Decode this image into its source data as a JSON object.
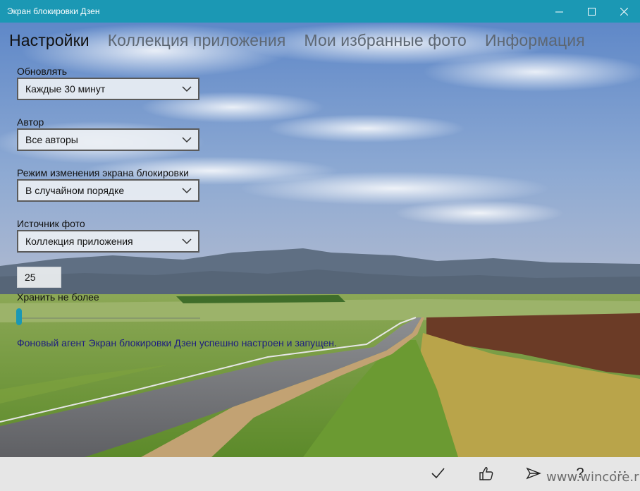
{
  "window": {
    "title": "Экран блокировки Дзен",
    "minimize_icon": "minimize-icon",
    "maximize_icon": "maximize-icon",
    "close_icon": "close-icon"
  },
  "tabs": [
    {
      "label": "Настройки",
      "active": true
    },
    {
      "label": "Коллекция приложения",
      "active": false
    },
    {
      "label": "Мои избранные фото",
      "active": false
    },
    {
      "label": "Информация",
      "active": false
    }
  ],
  "settings": {
    "update": {
      "label": "Обновлять",
      "value": "Каждые 30 минут"
    },
    "author": {
      "label": "Автор",
      "value": "Все авторы"
    },
    "mode": {
      "label": "Режим изменения экрана блокировки",
      "value": "В случайном порядке"
    },
    "source": {
      "label": "Источник фото",
      "value": "Коллекция приложения"
    },
    "keep": {
      "value": "25",
      "label": "Хранить не более",
      "slider_level": 0.0
    }
  },
  "status_message": "Фоновый агент Экран блокировки Дзен успешно настроен и запущен.",
  "appbar": {
    "icons": [
      "checkmark-icon",
      "thumbs-up-icon",
      "send-icon",
      "help-icon"
    ],
    "help_glyph": "?",
    "more": "..."
  },
  "watermark": "www.wincore.ru",
  "colors": {
    "accent": "#1b98b4",
    "status_text": "#1d1d80",
    "appbar_bg": "#e6e6e6"
  }
}
